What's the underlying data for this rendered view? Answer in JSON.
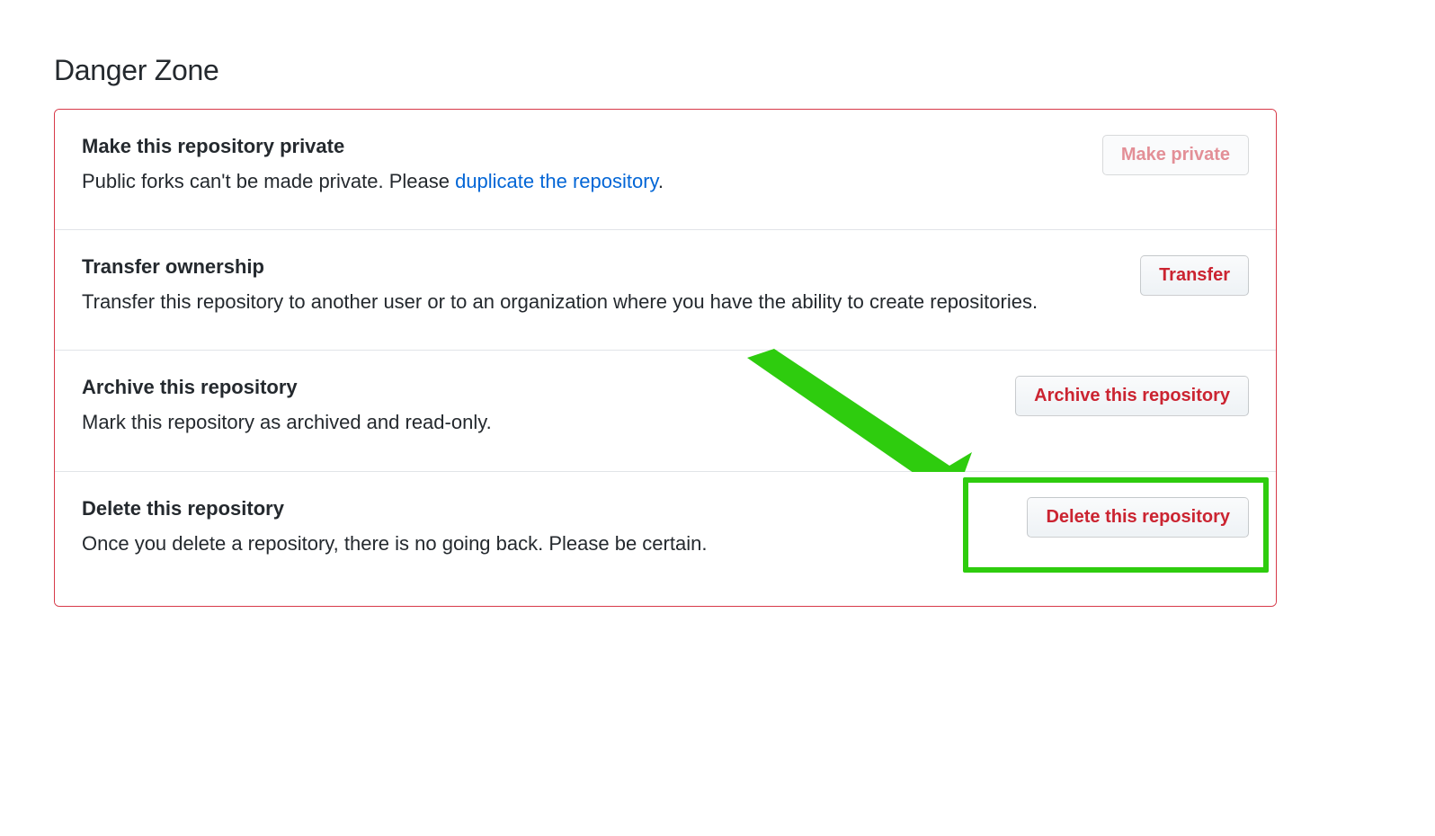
{
  "heading": "Danger Zone",
  "rows": {
    "make_private": {
      "title": "Make this repository private",
      "desc_prefix": "Public forks can't be made private. Please ",
      "link_text": "duplicate the repository",
      "desc_suffix": ".",
      "button_label": "Make private"
    },
    "transfer": {
      "title": "Transfer ownership",
      "desc": "Transfer this repository to another user or to an organization where you have the ability to create repositories.",
      "button_label": "Transfer"
    },
    "archive": {
      "title": "Archive this repository",
      "desc": "Mark this repository as archived and read-only.",
      "button_label": "Archive this repository"
    },
    "delete": {
      "title": "Delete this repository",
      "desc": "Once you delete a repository, there is no going back. Please be certain.",
      "button_label": "Delete this repository"
    }
  }
}
